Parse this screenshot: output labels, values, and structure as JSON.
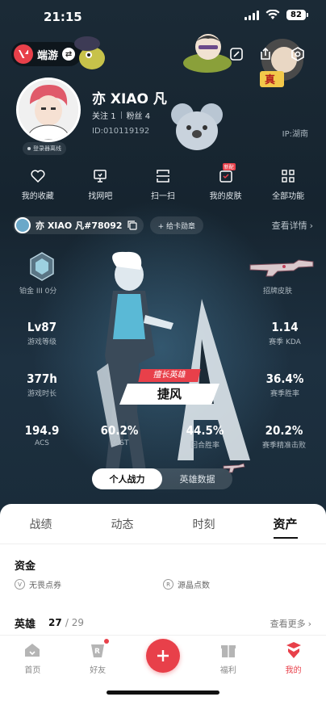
{
  "status_bar": {
    "time": "21:15",
    "battery": "82"
  },
  "header": {
    "brand_name": "端游"
  },
  "profile": {
    "nickname": "亦 XIAO 凡",
    "following_label": "关注",
    "following_count": "1",
    "fans_label": "粉丝",
    "fans_count": "4",
    "uid": "ID:010119192",
    "ip": "IP:湖南",
    "login_status": "登录器离线"
  },
  "quick_actions": [
    {
      "label": "我的收藏",
      "icon": "heart-icon"
    },
    {
      "label": "找网吧",
      "icon": "monitor-icon"
    },
    {
      "label": "扫一扫",
      "icon": "scan-icon"
    },
    {
      "label": "我的皮肤",
      "icon": "skin-icon",
      "tag": "新配"
    },
    {
      "label": "全部功能",
      "icon": "grid-icon"
    }
  ],
  "riot_id": {
    "name": "亦 XIAO 凡#78092",
    "badge_label": "+ 给卡勋章",
    "detail_link": "查看详情"
  },
  "rank": {
    "label": "铂金 III 0分"
  },
  "signature_skin": {
    "label": "招牌皮肤"
  },
  "stats": {
    "level": {
      "value": "Lv87",
      "label": "游戏等级"
    },
    "kda": {
      "value": "1.14",
      "label": "赛季 KDA"
    },
    "playtime": {
      "value": "377h",
      "label": "游戏时长"
    },
    "winrate": {
      "value": "36.4%",
      "label": "赛季胜率"
    },
    "acs": {
      "value": "194.9",
      "label": "ACS"
    },
    "kast": {
      "value": "60.2%",
      "label": "KAST"
    },
    "round_winrate": {
      "value": "44.5%",
      "label": "回合胜率"
    },
    "precision_kill": {
      "value": "20.2%",
      "label": "赛季精准击败"
    }
  },
  "agent": {
    "tag": "擅长英雄",
    "name": "捷风"
  },
  "toggle": {
    "options": [
      "个人战力",
      "英雄数据"
    ],
    "active": 0
  },
  "tabs": [
    "战绩",
    "动态",
    "时刻",
    "资产"
  ],
  "active_tab": 3,
  "assets": {
    "funds_title": "资金",
    "currencies": [
      "无畏点券",
      "源晶点数"
    ],
    "heroes_title": "英雄",
    "heroes_owned": "27",
    "heroes_total": "/ 29",
    "more_link": "查看更多"
  },
  "bottom_nav": [
    {
      "label": "首页",
      "icon": "home-icon"
    },
    {
      "label": "好友",
      "icon": "friends-icon"
    },
    {
      "label": "",
      "icon": "plus-icon"
    },
    {
      "label": "福利",
      "icon": "gift-icon"
    },
    {
      "label": "我的",
      "icon": "profile-icon"
    }
  ],
  "colors": {
    "accent": "#e8404a",
    "hero_bg": "#16242f",
    "sheet_bg": "#ffffff"
  }
}
